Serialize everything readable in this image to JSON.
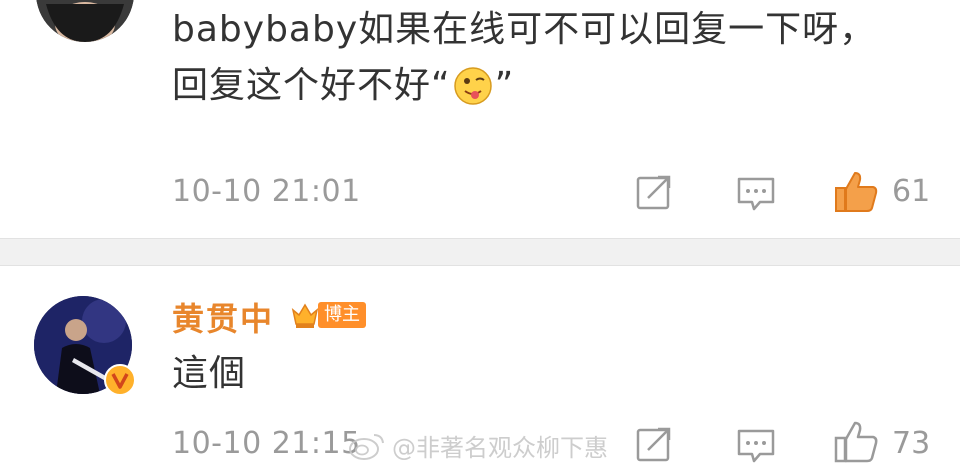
{
  "comments": [
    {
      "text_line1": "babybaby如果在线可不可以回复一下呀，",
      "text_line2_before": "回复这个好不好“",
      "text_line2_after": "”",
      "emoji": "tongue-emoji",
      "time": "10-10 21:01",
      "likes": "61",
      "liked": true
    },
    {
      "username": "黄贯中",
      "badge": "博主",
      "text": "這個",
      "time": "10-10 21:15",
      "likes": "73",
      "liked": false
    }
  ],
  "watermark": "@非著名观众柳下惠",
  "colors": {
    "username": "#e8862c",
    "liked": "#f08a24",
    "meta": "#9a9a9a",
    "badge": "#ff8f2a"
  },
  "icons": [
    "share-icon",
    "comment-icon",
    "like-icon",
    "verified-v-icon",
    "crown-icon",
    "weibo-logo-icon"
  ]
}
